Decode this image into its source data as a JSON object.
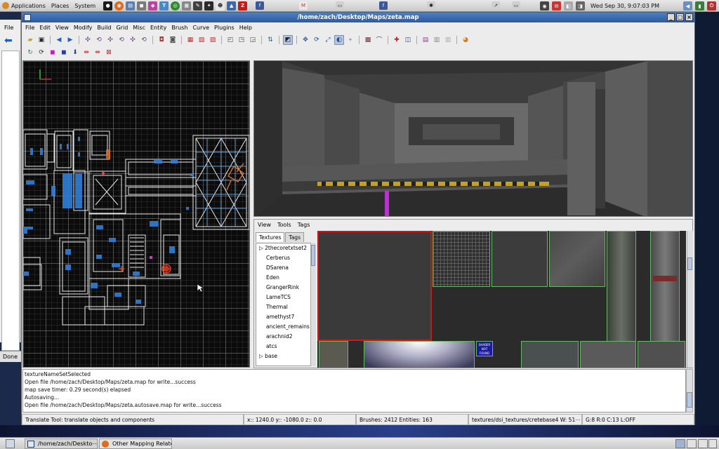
{
  "top_panel": {
    "menus": [
      "Applications",
      "Places",
      "System"
    ],
    "clock": "Wed Sep 30,  9:07:03 PM"
  },
  "background_window": {
    "menu_file": "File",
    "status": "Done"
  },
  "window": {
    "title": "/home/zach/Desktop/Maps/zeta.map",
    "menus": [
      "File",
      "Edit",
      "View",
      "Modify",
      "Build",
      "Grid",
      "Misc",
      "Entity",
      "Brush",
      "Curve",
      "Plugins",
      "Help"
    ]
  },
  "texture_browser": {
    "menus": [
      "View",
      "Tools",
      "Tags"
    ],
    "tabs": [
      "Textures",
      "Tags"
    ],
    "tree_items": [
      "2thecoretxtset2",
      "Cerberus",
      "DSarena",
      "Eden",
      "GrangerRink",
      "LameTCS",
      "Thermal",
      "amethyst7",
      "ancient_remains",
      "arachnid2",
      "atcs",
      "base"
    ],
    "shader_label": "SHADER NOT FOUND"
  },
  "console": {
    "lines": [
      "textureNameSetSelected",
      "Open file /home/zach/Desktop/Maps/zeta.map for write...success",
      "map save timer:  0.29 second(s) elapsed",
      "Autosaving...",
      "Open file /home/zach/Desktop/Maps/zeta.autosave.map for write...success"
    ]
  },
  "status_bar": {
    "tool": "Translate Tool: translate objects and components",
    "coords": "x::  1240.0  y:: -1080.0  z::     0.0",
    "counts": "Brushes: 2412 Entities: 163",
    "texture": "textures/dsi_textures/cretebase4 W: 51⋯",
    "grid": "G:8  R:0  C:13  L:OFF"
  },
  "bottom_panel": {
    "tasks": [
      "/home/zach/Deskto⋯",
      "Other Mapping Relate⋯"
    ]
  }
}
